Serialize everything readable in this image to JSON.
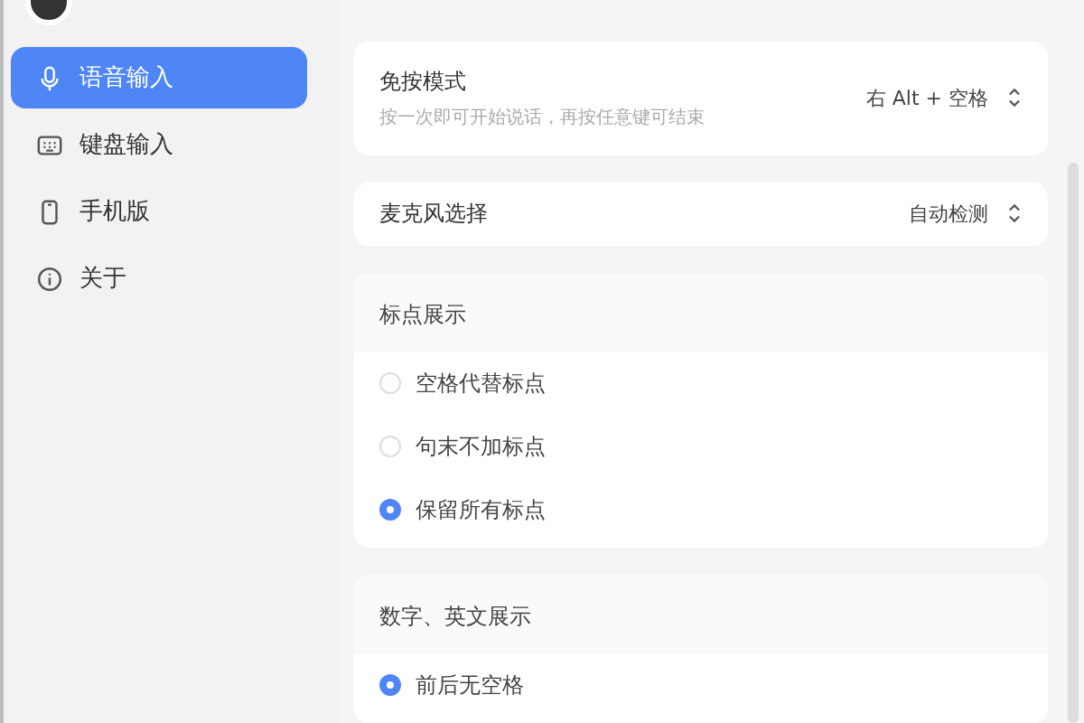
{
  "sidebar": {
    "items": [
      {
        "label": "语音输入",
        "kind": "mic",
        "selected": true
      },
      {
        "label": "键盘输入",
        "kind": "keyboard",
        "selected": false
      },
      {
        "label": "手机版",
        "kind": "phone",
        "selected": false
      },
      {
        "label": "关于",
        "kind": "info",
        "selected": false
      }
    ]
  },
  "page": {
    "settings": [
      {
        "label": "免按模式",
        "description": "按一次即可开始说话，再按任意键可结束",
        "value": "右 Alt + 空格"
      },
      {
        "label": "麦克风选择",
        "value": "自动检测"
      }
    ],
    "groups": [
      {
        "title": "标点展示",
        "options": [
          {
            "label": "空格代替标点",
            "selected": false
          },
          {
            "label": "句末不加标点",
            "selected": false
          },
          {
            "label": "保留所有标点",
            "selected": true
          }
        ]
      },
      {
        "title": "数字、英文展示",
        "options": [
          {
            "label": "前后无空格",
            "selected": true
          }
        ]
      }
    ]
  }
}
